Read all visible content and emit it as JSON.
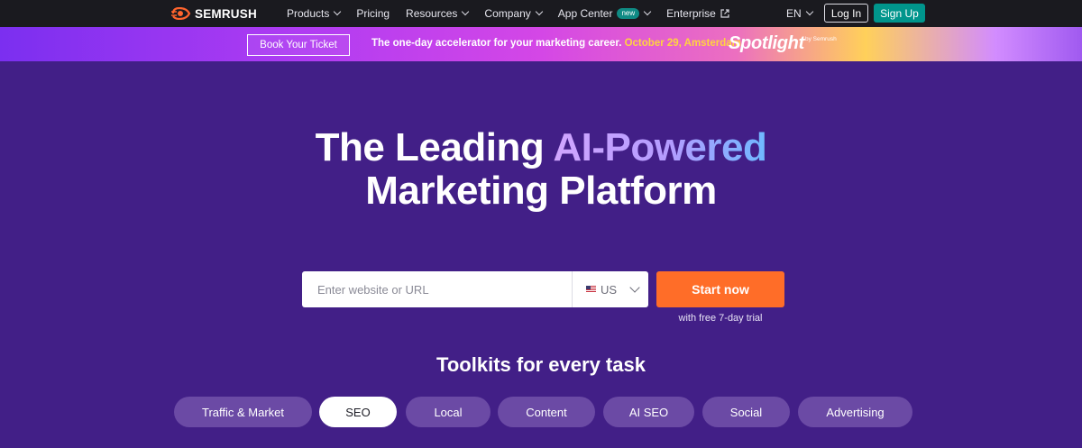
{
  "nav": {
    "logo_text": "SEMRUSH",
    "logo_color": "#ff642d",
    "menu": [
      {
        "label": "Products",
        "chevron": true
      },
      {
        "label": "Pricing",
        "chevron": false
      },
      {
        "label": "Resources",
        "chevron": true
      },
      {
        "label": "Company",
        "chevron": true
      },
      {
        "label": "App Center",
        "badge": "new",
        "chevron": true
      },
      {
        "label": "Enterprise",
        "external": true
      }
    ],
    "language": "EN",
    "login_label": "Log In",
    "signup_label": "Sign Up"
  },
  "promo": {
    "button_label": "Book Your Ticket",
    "text": "The one-day accelerator for your marketing career.",
    "date_location": "October 29, Amsterdam",
    "brand": "Spotlight",
    "brand_by": "by Semrush"
  },
  "hero": {
    "title_part1": "The Leading ",
    "title_highlight": "AI-Powered",
    "title_line2": "Marketing Platform",
    "search_placeholder": "Enter website or URL",
    "country": "US",
    "cta_label": "Start now",
    "trial_text": "with free 7-day trial"
  },
  "toolkits": {
    "title": "Toolkits for every task",
    "tabs": [
      {
        "label": "Traffic & Market",
        "active": false
      },
      {
        "label": "SEO",
        "active": true
      },
      {
        "label": "Local",
        "active": false
      },
      {
        "label": "Content",
        "active": false
      },
      {
        "label": "AI SEO",
        "active": false
      },
      {
        "label": "Social",
        "active": false
      },
      {
        "label": "Advertising",
        "active": false
      }
    ]
  },
  "colors": {
    "background": "#421f87",
    "nav_bg": "#1a1a1f",
    "accent_orange": "#ff6d28",
    "accent_teal": "#00958c"
  }
}
